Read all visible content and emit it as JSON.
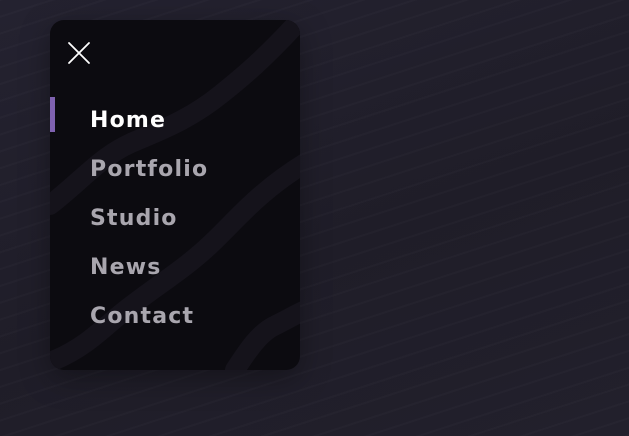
{
  "colors": {
    "page_background": "#201e29",
    "panel_background": "#0c0b10",
    "active_text": "#ffffff",
    "inactive_text": "#a9a6ae",
    "active_indicator": "#7f62b0",
    "close_icon": "#ffffff"
  },
  "menu": {
    "close_icon": "close-icon",
    "active_index": 0,
    "items": [
      {
        "label": "Home",
        "active": true
      },
      {
        "label": "Portfolio",
        "active": false
      },
      {
        "label": "Studio",
        "active": false
      },
      {
        "label": "News",
        "active": false
      },
      {
        "label": "Contact",
        "active": false
      }
    ]
  }
}
